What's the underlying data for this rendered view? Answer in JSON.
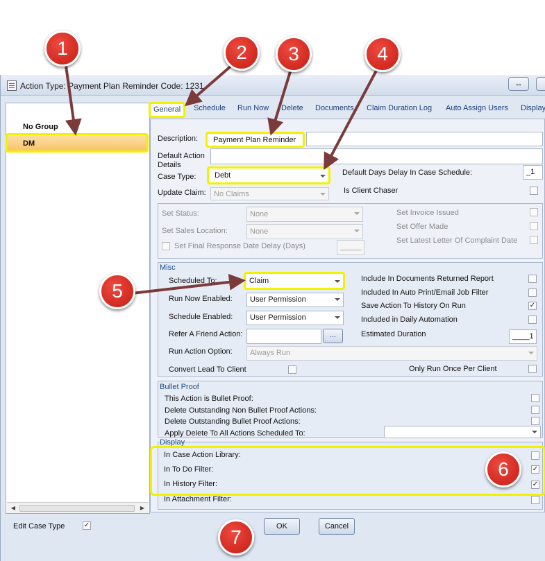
{
  "window": {
    "title": "Action Type: Payment Plan Reminder Code: 1231"
  },
  "left_panel": {
    "groups": [
      "No Group",
      "DM"
    ],
    "selected": "DM",
    "edit_case_type_label": "Edit Case Type",
    "edit_case_type_checked": true
  },
  "tabs": [
    "General",
    "Schedule",
    "Run Now",
    "Delete",
    "Documents",
    "Claim Duration Log",
    "Auto Assign Users",
    "Display"
  ],
  "general": {
    "description_label": "Description:",
    "description_value": "Payment Plan Reminder",
    "default_action_details_label": "Default Action Details",
    "case_type_label": "Case Type:",
    "case_type_value": "Debt",
    "update_claim_label": "Update Claim:",
    "update_claim_value": "No Claims",
    "default_days_label": "Default Days Delay In Case Schedule:",
    "default_days_value": "_1",
    "is_client_chaser_label": "Is Client Chaser"
  },
  "status_group": {
    "set_status_label": "Set Status:",
    "set_status_value": "None",
    "set_sales_location_label": "Set Sales Location:",
    "set_sales_location_value": "None",
    "set_final_response_label": "Set Final Response Date Delay (Days)",
    "final_response_value": "_____",
    "set_invoice_issued_label": "Set Invoice Issued",
    "set_offer_made_label": "Set Offer Made",
    "set_latest_letter_label": "Set Latest Letter Of Complaint Date"
  },
  "misc": {
    "title": "Misc",
    "scheduled_to_label": "Scheduled To:",
    "scheduled_to_value": "Claim",
    "run_now_enabled_label": "Run Now Enabled:",
    "run_now_enabled_value": "User Permission",
    "schedule_enabled_label": "Schedule Enabled:",
    "schedule_enabled_value": "User Permission",
    "refer_friend_label": "Refer A Friend Action:",
    "refer_friend_button": "...",
    "run_action_option_label": "Run Action Option:",
    "run_action_option_value": "Always Run",
    "convert_lead_label": "Convert Lead To Client",
    "include_docs_label": "Include In Documents Returned Report",
    "included_auto_print_label": "Included In Auto Print/Email Job Filter",
    "save_action_history_label": "Save Action To History On Run",
    "save_action_history_checked": true,
    "included_daily_label": "Included in Daily Automation",
    "estimated_duration_label": "Estimated Duration",
    "estimated_duration_value": "____1",
    "only_run_once_label": "Only Run Once Per Client"
  },
  "bullet_proof": {
    "title": "Bullet Proof",
    "items": [
      "This Action is Bullet Proof:",
      "Delete Outstanding Non Bullet Proof Actions:",
      "Delete Outstanding Bullet Proof Actions:",
      "Apply Delete To All Actions Scheduled To:"
    ]
  },
  "display": {
    "title": "Display",
    "items": [
      {
        "label": "In Case Action Library:",
        "checked": false
      },
      {
        "label": "In To Do Filter:",
        "checked": true
      },
      {
        "label": "In History Filter:",
        "checked": true
      },
      {
        "label": "In Attachment Filter:",
        "checked": false
      }
    ]
  },
  "buttons": {
    "ok": "OK",
    "cancel": "Cancel"
  },
  "callouts": [
    "1",
    "2",
    "3",
    "4",
    "5",
    "6",
    "7"
  ],
  "colors": {
    "highlight": "#f2f200",
    "callout": "#d02a20",
    "arrow": "#7b3b3b",
    "selected_row": "#f8c46a"
  }
}
